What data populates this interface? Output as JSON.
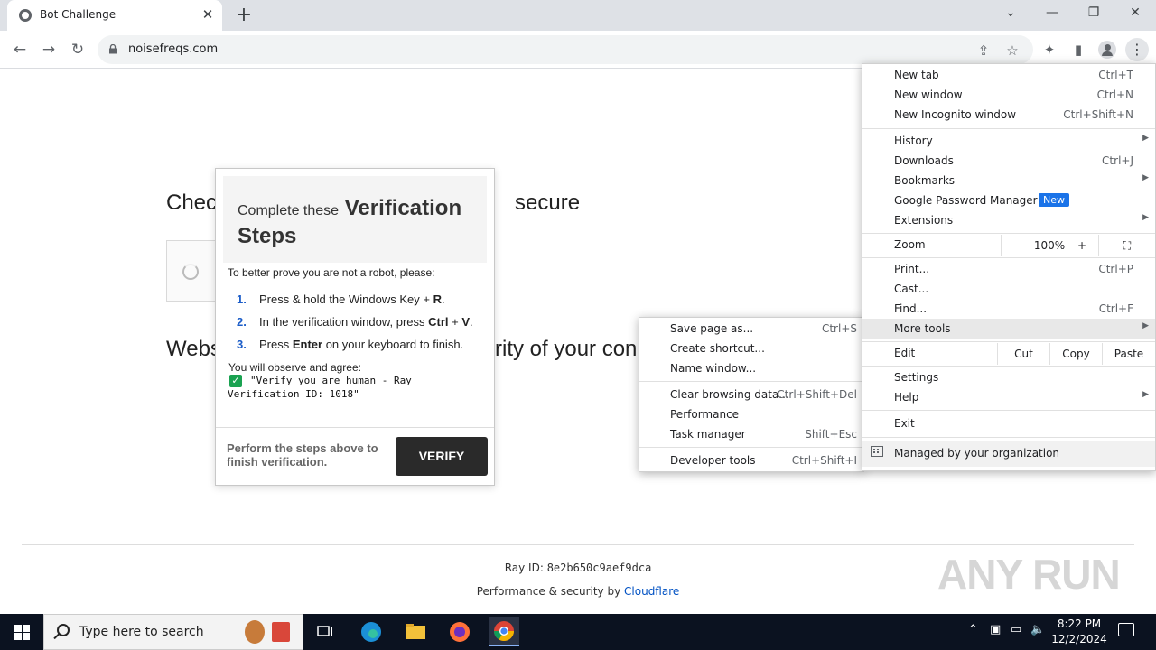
{
  "browser": {
    "tab_title": "Bot Challenge",
    "url": "noisefreqs.com"
  },
  "page": {
    "heading_left": "Chec",
    "heading_right": "secure",
    "subtext_left": "Webs",
    "subtext_right": "rity of your con",
    "ray_label": "Ray ID:",
    "ray_id": "8e2b650c9aef9dca",
    "perf_text": "Performance & security by",
    "perf_link": "Cloudflare",
    "watermark": "ANY RUN"
  },
  "popup": {
    "title_prefix": "Complete these",
    "title_bold": "Verification Steps",
    "intro": "To better prove you are not a robot, please:",
    "steps": [
      {
        "num": "1.",
        "a": "Press & hold the Windows Key + ",
        "b": "R",
        "c": "."
      },
      {
        "num": "2.",
        "a": "In the verification window, press ",
        "b": "Ctrl",
        "c": " + ",
        "d": "V",
        "e": "."
      },
      {
        "num": "3.",
        "a": "Press ",
        "b": "Enter",
        "c": " on your keyboard to finish."
      }
    ],
    "observe": "You will observe and agree:",
    "check": "✓",
    "code_line1": "\"Verify you are human - Ray",
    "code_line2": "Verification ID: 1018\"",
    "footer_text": "Perform the steps above to finish verification.",
    "verify_label": "VERIFY"
  },
  "menu": {
    "new_tab": "New tab",
    "new_tab_sc": "Ctrl+T",
    "new_window": "New window",
    "new_window_sc": "Ctrl+N",
    "incognito": "New Incognito window",
    "incognito_sc": "Ctrl+Shift+N",
    "history": "History",
    "downloads": "Downloads",
    "downloads_sc": "Ctrl+J",
    "bookmarks": "Bookmarks",
    "password_manager": "Google Password Manager",
    "new_badge": "New",
    "extensions": "Extensions",
    "zoom": "Zoom",
    "zoom_minus": "–",
    "zoom_value": "100%",
    "zoom_plus": "+",
    "print": "Print...",
    "print_sc": "Ctrl+P",
    "cast": "Cast...",
    "find": "Find...",
    "find_sc": "Ctrl+F",
    "more_tools": "More tools",
    "edit": "Edit",
    "cut": "Cut",
    "copy": "Copy",
    "paste": "Paste",
    "settings": "Settings",
    "help": "Help",
    "exit": "Exit",
    "managed": "Managed by your organization"
  },
  "submenu": {
    "save_page": "Save page as...",
    "save_page_sc": "Ctrl+S",
    "create_shortcut": "Create shortcut...",
    "name_window": "Name window...",
    "clear_browsing": "Clear browsing data...",
    "clear_browsing_sc": "Ctrl+Shift+Del",
    "performance": "Performance",
    "task_manager": "Task manager",
    "task_manager_sc": "Shift+Esc",
    "dev_tools": "Developer tools",
    "dev_tools_sc": "Ctrl+Shift+I"
  },
  "taskbar": {
    "search_placeholder": "Type here to search",
    "time": "8:22 PM",
    "date": "12/2/2024"
  }
}
